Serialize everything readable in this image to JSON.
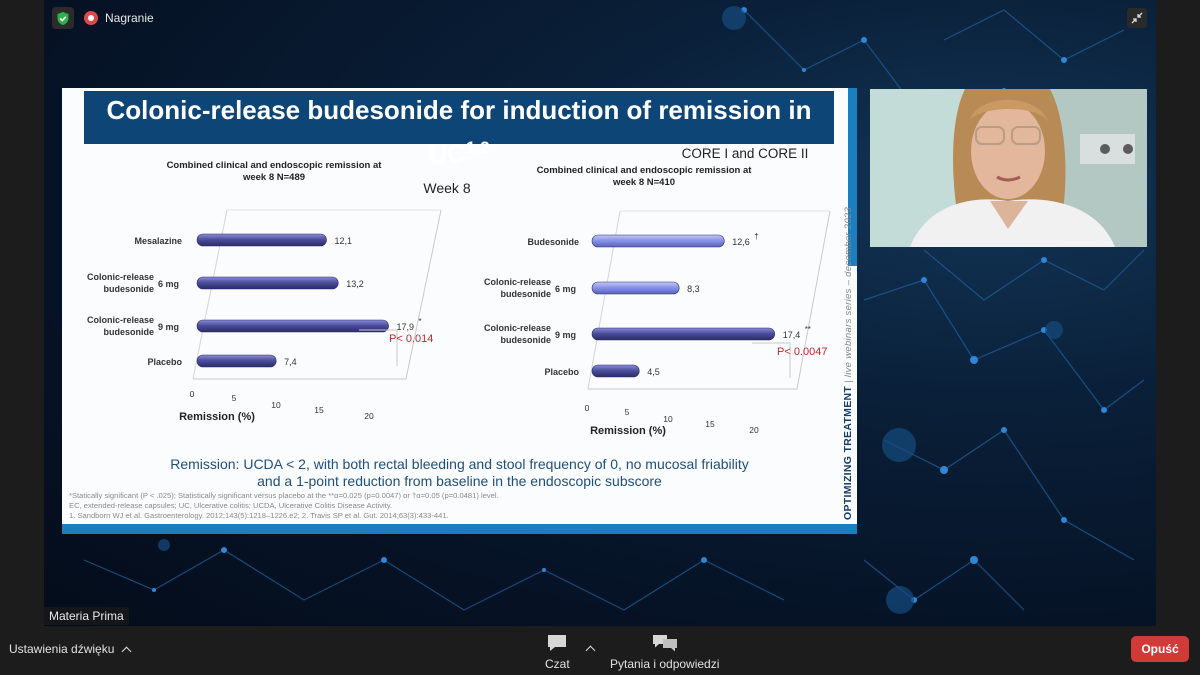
{
  "topbar": {
    "recording_label": "Nagranie"
  },
  "slide": {
    "title": "Colonic-release budesonide for induction of remission in UC",
    "title_sup": "1,2",
    "vertical_text": {
      "main": "OPTIMIZING TREATMENT",
      "sub": "| live webinars series – december 2023"
    },
    "remission_line1": "Remission: UCDA < 2, with both rectal bleeding and stool frequency  of 0, no mucosal friability",
    "remission_line2": "and a 1-point  reduction from baseline in the endoscopic subscore",
    "footnote_1": "*Statically significant (P < .025); Statistically significant versus placebo at the **α=0.025 (p=0.0047) or †α=0.05 (p=0.0481) level.",
    "footnote_2": "EC, extended-release capsules; UC, Ulcerative colitis; UCDA, Ulcerative Colitis Disease Activity.",
    "footnote_3": "1. Sandborn WJ et al. Gastroenterology. 2012;143(5):1218–1226.e2; 2. Travis SP et al. Gut. 2014;63(3):433-441.",
    "colors": {
      "header": "#0d4577",
      "accent": "#1b7fbf",
      "bar_dark": "#4d4f9e",
      "bar_light": "#8a94e8",
      "pvalue": "#c0282d"
    }
  },
  "chart_data": [
    {
      "type": "bar",
      "orientation": "horizontal",
      "title": "Combined clinical and endoscopic remission at week 8 N=489",
      "subtitle": "Week 8",
      "xlabel": "Remission (%)",
      "xlim": [
        0,
        20
      ],
      "xticks": [
        "0",
        "5",
        "10",
        "15",
        "20"
      ],
      "categories": [
        {
          "label": "Mesalazine",
          "dose": ""
        },
        {
          "label": "Colonic-release budesonide",
          "dose": "6 mg"
        },
        {
          "label": "Colonic-release budesonide",
          "dose": "9 mg"
        },
        {
          "label": "Placebo",
          "dose": ""
        }
      ],
      "values": [
        12.1,
        13.2,
        17.9,
        7.4
      ],
      "value_labels": [
        "12,1",
        "13,2",
        "17,9",
        "7,4"
      ],
      "markers": [
        "",
        "",
        "*",
        ""
      ],
      "annotation": "P< 0.014"
    },
    {
      "type": "bar",
      "orientation": "horizontal",
      "title": "Combined clinical and endoscopic remission at week 8 N=410",
      "subtitle": "CORE I and CORE II",
      "xlabel": "Remission (%)",
      "xlim": [
        0,
        20
      ],
      "xticks": [
        "0",
        "5",
        "10",
        "15",
        "20"
      ],
      "categories": [
        {
          "label": "Budesonide",
          "dose": ""
        },
        {
          "label": "Colonic-release budesonide",
          "dose": "6 mg"
        },
        {
          "label": "Colonic-release budesonide",
          "dose": "9 mg"
        },
        {
          "label": "Placebo",
          "dose": ""
        }
      ],
      "values": [
        12.6,
        8.3,
        17.4,
        4.5
      ],
      "value_labels": [
        "12,6",
        "8,3",
        "17,4",
        "4,5"
      ],
      "markers": [
        "†",
        "",
        "**",
        ""
      ],
      "annotation": "P< 0.0047"
    }
  ],
  "participant_name": "Materia Prima",
  "bottombar": {
    "audio_settings": "Ustawienia dźwięku",
    "chat": "Czat",
    "qa": "Pytania i odpowiedzi",
    "leave": "Opuść"
  }
}
